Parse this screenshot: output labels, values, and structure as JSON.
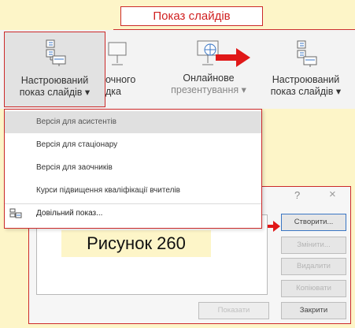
{
  "tab": {
    "title": "Показ слайдів"
  },
  "ribbon": {
    "custom_left": {
      "line1": "Настроюваний",
      "line2": "показ слайдів ▾"
    },
    "from_start": {
      "line1": "очного",
      "line2": "дка"
    },
    "online": {
      "line1": "Онлайнове",
      "line2": "презентування ▾"
    },
    "custom_right": {
      "line1": "Настроюваний",
      "line2": "показ слайдів ▾"
    }
  },
  "dropdown": {
    "items": [
      {
        "label": "Версія для асистентів",
        "selected": true
      },
      {
        "label": "Версія для стаціонару",
        "selected": false
      },
      {
        "label": "Версія для заочників",
        "selected": false
      },
      {
        "label": "Курси підвищення кваліфікації вчителів",
        "selected": false
      }
    ],
    "footer": "Довільний показ..."
  },
  "dialog": {
    "help": "?",
    "close_glyph": "×",
    "buttons": {
      "new": "Створити...",
      "edit": "Змінити...",
      "remove": "Видалити",
      "copy": "Копіювати",
      "show": "Показати",
      "close": "Закрити"
    }
  },
  "caption": "Рисунок 260",
  "colors": {
    "accent_red": "#cc2a2a",
    "background": "#fdf5c8"
  }
}
